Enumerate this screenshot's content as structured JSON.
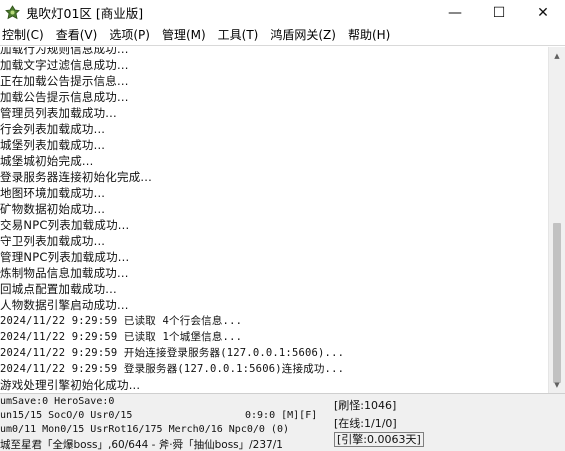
{
  "window": {
    "title": "鬼吹灯01区 [商业版]",
    "minimize_glyph": "—",
    "maximize_glyph": "☐",
    "close_glyph": "✕",
    "icon": "game-app-icon"
  },
  "menu": [
    "控制(C)",
    "查看(V)",
    "选项(P)",
    "管理(M)",
    "工具(T)",
    "鸿盾网关(Z)",
    "帮助(H)"
  ],
  "log_lines": [
    "加载行为规则信息成功...",
    "加载文字过滤信息成功...",
    "正在加载公告提示信息...",
    "加载公告提示信息成功...",
    "管理员列表加载成功...",
    "行会列表加载成功...",
    "城堡列表加载成功...",
    "城堡城初始完成...",
    "登录服务器连接初始化完成...",
    "地图环境加载成功...",
    "矿物数据初始成功...",
    "交易NPC列表加载成功...",
    "守卫列表加载成功...",
    "管理NPC列表加载成功...",
    "炼制物品信息加载成功...",
    "回城点配置加载成功...",
    "人物数据引擎启动成功...",
    "2024/11/22 9:29:59 已读取 4个行会信息...",
    "2024/11/22 9:29:59 已读取 1个城堡信息...",
    "2024/11/22 9:29:59 开始连接登录服务器(127.0.0.1:5606)...",
    "2024/11/22 9:29:59 登录服务器(127.0.0.1:5606)连接成功...",
    "游戏处理引擎初始化成功..."
  ],
  "status": {
    "line1": "umSave:0 HeroSave:0",
    "line2_left": "un15/15 SocO/0 Usr0/15",
    "line2_mid": "0:9:0 [M][F]",
    "line3": "um0/11 Mon0/15 UsrRot16/175 Merch0/16 Npc0/0 (0)",
    "line4": "城至星君「全爆boss」,60/644 - 斧·舜「抽仙boss」/237/1",
    "refresh": "[刷怪:1046]",
    "online": "[在线:1/1/0]",
    "engine": "[引擎:0.0063天]"
  }
}
